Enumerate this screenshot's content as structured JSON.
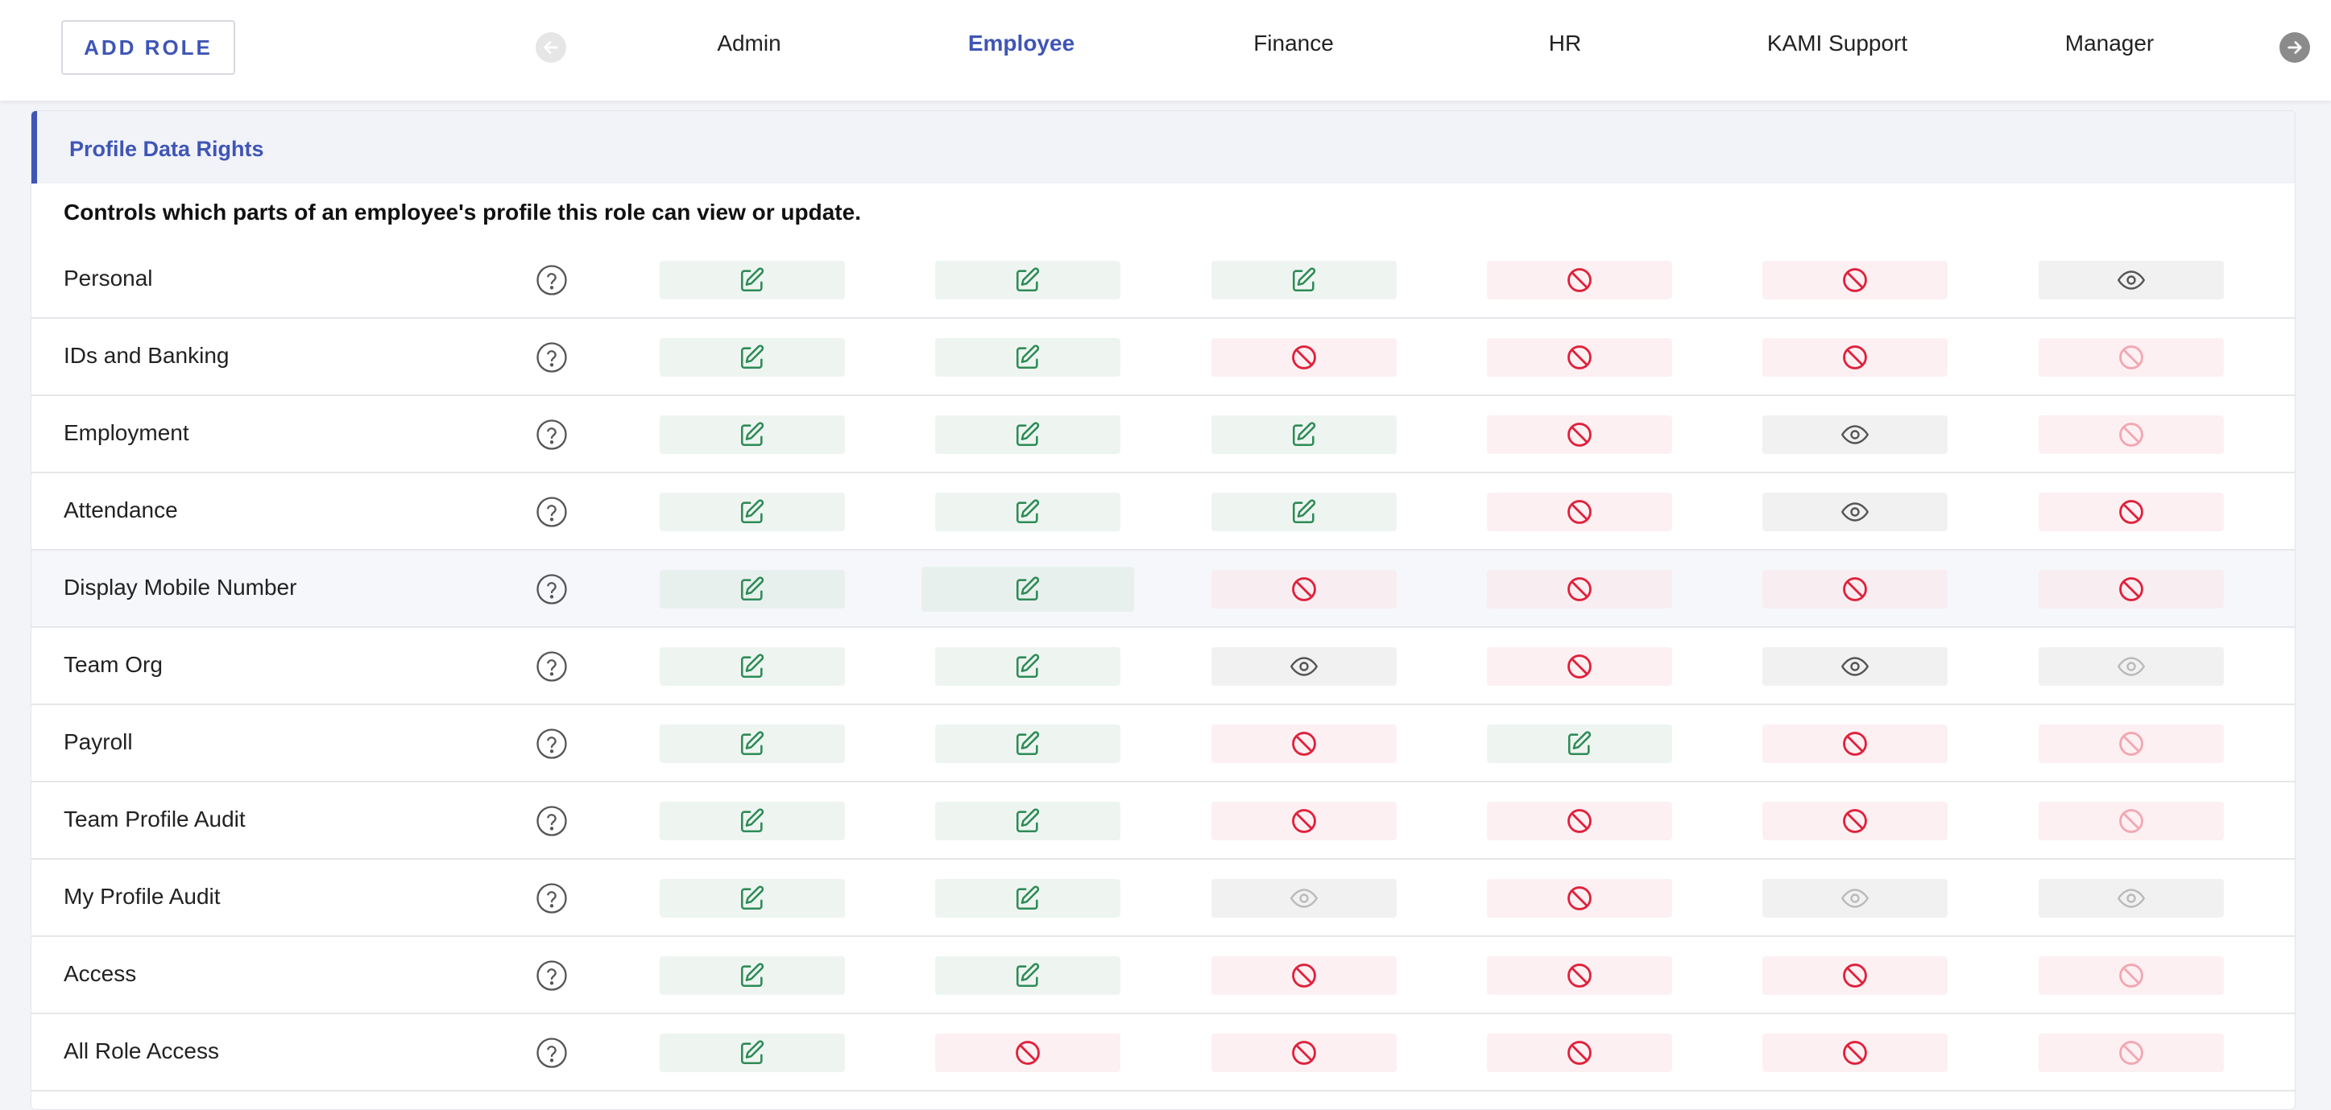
{
  "toolbar": {
    "add_role_label": "ADD ROLE"
  },
  "tabs": [
    {
      "label": "Admin",
      "active": false
    },
    {
      "label": "Employee",
      "active": true
    },
    {
      "label": "Finance",
      "active": false
    },
    {
      "label": "HR",
      "active": false
    },
    {
      "label": "KAMI Support",
      "active": false
    },
    {
      "label": "Manager",
      "active": false
    }
  ],
  "nav": {
    "prev_icon": "arrow-left-icon",
    "next_icon": "arrow-right-icon"
  },
  "section": {
    "title": "Profile Data Rights",
    "description": "Controls which parts of an employee's profile this role can view or update."
  },
  "legend_icons": {
    "edit": "edit-icon",
    "view": "eye-icon",
    "deny": "ban-icon",
    "help": "help-circle-icon"
  },
  "colors": {
    "accent": "#3f55b6",
    "edit": "#2e8b57",
    "deny": "#e0213c",
    "view": "#555555"
  },
  "rows": [
    {
      "label": "Personal",
      "perms": [
        "edit",
        "edit",
        "edit",
        "deny",
        "deny",
        "view"
      ]
    },
    {
      "label": "IDs and Banking",
      "perms": [
        "edit",
        "edit",
        "deny",
        "deny",
        "deny",
        "deny-faded"
      ]
    },
    {
      "label": "Employment",
      "perms": [
        "edit",
        "edit",
        "edit",
        "deny",
        "view",
        "deny-faded"
      ]
    },
    {
      "label": "Attendance",
      "perms": [
        "edit",
        "edit",
        "edit",
        "deny",
        "view",
        "deny"
      ]
    },
    {
      "label": "Display Mobile Number",
      "perms": [
        "edit",
        "edit",
        "deny",
        "deny",
        "deny",
        "deny"
      ]
    },
    {
      "label": "Team Org",
      "perms": [
        "edit",
        "edit",
        "view",
        "deny",
        "view",
        "view-faded"
      ]
    },
    {
      "label": "Payroll",
      "perms": [
        "edit",
        "edit",
        "deny",
        "edit",
        "deny",
        "deny-faded"
      ]
    },
    {
      "label": "Team Profile Audit",
      "perms": [
        "edit",
        "edit",
        "deny",
        "deny",
        "deny",
        "deny-faded"
      ]
    },
    {
      "label": "My Profile Audit",
      "perms": [
        "edit",
        "edit",
        "view-faded",
        "deny",
        "view-faded",
        "view-faded"
      ]
    },
    {
      "label": "Access",
      "perms": [
        "edit",
        "edit",
        "deny",
        "deny",
        "deny",
        "deny-faded"
      ]
    },
    {
      "label": "All Role Access",
      "perms": [
        "edit",
        "deny",
        "deny",
        "deny",
        "deny",
        "deny-faded"
      ]
    }
  ]
}
